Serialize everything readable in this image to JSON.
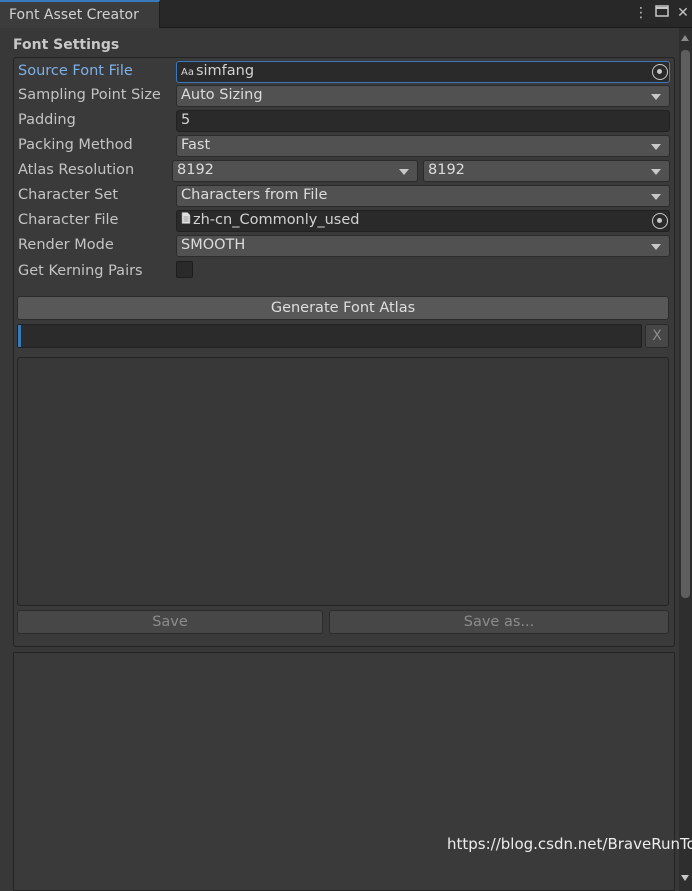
{
  "window": {
    "tab_title": "Font Asset Creator",
    "menu_icon": "kebab-menu-icon",
    "maximize_icon": "maximize-icon",
    "close_icon": "close-icon"
  },
  "settings": {
    "section_title": "Font Settings",
    "source_font_file": {
      "label": "Source Font File",
      "icon": "Aa",
      "value": "simfang"
    },
    "sampling_point_size": {
      "label": "Sampling Point Size",
      "value": "Auto Sizing"
    },
    "padding": {
      "label": "Padding",
      "value": "5"
    },
    "packing_method": {
      "label": "Packing Method",
      "value": "Fast"
    },
    "atlas_resolution": {
      "label": "Atlas Resolution",
      "width": "8192",
      "height": "8192"
    },
    "character_set": {
      "label": "Character Set",
      "value": "Characters from File"
    },
    "character_file": {
      "label": "Character File",
      "value": "zh-cn_Commonly_used"
    },
    "render_mode": {
      "label": "Render Mode",
      "value": "SMOOTH"
    },
    "get_kerning_pairs": {
      "label": "Get Kerning Pairs",
      "checked": false
    }
  },
  "actions": {
    "generate_label": "Generate Font Atlas",
    "clear_label": "X",
    "save_label": "Save",
    "save_as_label": "Save as..."
  },
  "watermark": "https://blog.csdn.net/BraveRunTo",
  "colors": {
    "accent": "#3a79bb",
    "active_label": "#7eb0e8",
    "background": "#383838"
  }
}
